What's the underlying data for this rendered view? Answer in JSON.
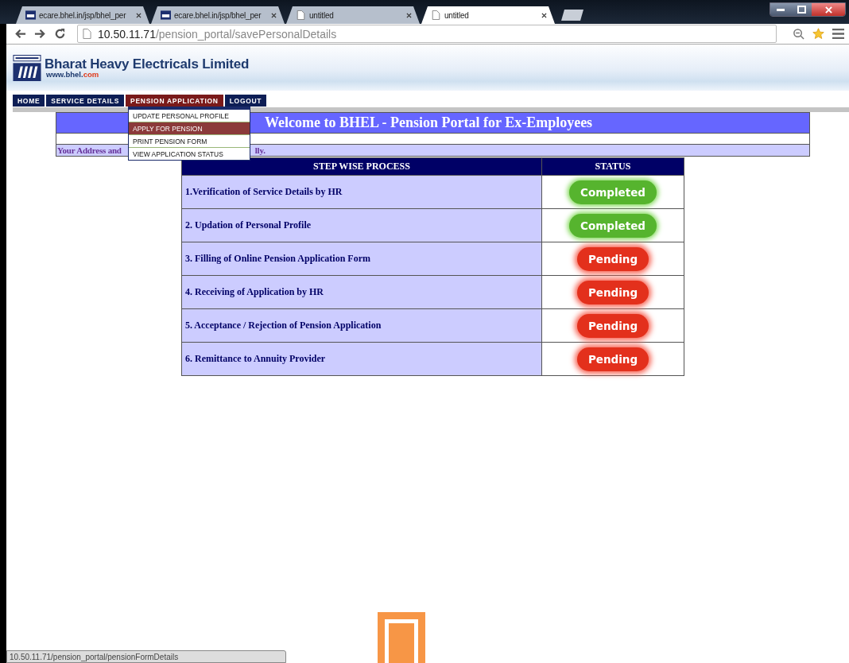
{
  "browser": {
    "tabs": [
      {
        "title": "ecare.bhel.in/jsp/bhel_per",
        "kind": "site",
        "selected": false
      },
      {
        "title": "ecare.bhel.in/jsp/bhel_per",
        "kind": "site",
        "selected": false
      },
      {
        "title": "untitled",
        "kind": "page",
        "selected": false
      },
      {
        "title": "untitled",
        "kind": "page",
        "selected": true
      }
    ],
    "url": {
      "host": "10.50.11.71",
      "path": "/pension_portal/savePersonalDetails"
    },
    "status_url": "10.50.11.71/pension_portal/pensionFormDetails"
  },
  "header": {
    "company": "Bharat Heavy Electricals Limited",
    "site": "www.bhel.",
    "site_tld": "com"
  },
  "nav": {
    "items": [
      {
        "label": "HOME",
        "selected": false
      },
      {
        "label": "SERVICE DETAILS",
        "selected": false
      },
      {
        "label": "PENSION APPLICATION",
        "selected": true
      },
      {
        "label": "LOGOUT",
        "selected": false
      }
    ],
    "dropdown": [
      {
        "label": "UPDATE PERSONAL PROFILE",
        "selected": false
      },
      {
        "label": "APPLY FOR PENSION",
        "selected": true
      },
      {
        "label": "PRINT PENSION FORM",
        "selected": false
      },
      {
        "label": "VIEW APPLICATION STATUS",
        "selected": false
      }
    ]
  },
  "welcome": {
    "title": "Welcome to BHEL - Pension Portal for Ex-Employees",
    "notice_start": "Your Address and",
    "notice_end": "lly."
  },
  "table": {
    "columns": [
      "STEP WISE PROCESS",
      "STATUS"
    ],
    "rows": [
      {
        "step": "1.Verification of Service Details by HR",
        "status": "Completed",
        "kind": "done"
      },
      {
        "step": "2. Updation of Personal Profile",
        "status": "Completed",
        "kind": "done"
      },
      {
        "step": "3. Filling of Online Pension Application Form",
        "status": "Pending",
        "kind": "pending"
      },
      {
        "step": "4. Receiving of Application by HR",
        "status": "Pending",
        "kind": "pending"
      },
      {
        "step": "5. Acceptance / Rejection of Pension Application",
        "status": "Pending",
        "kind": "pending"
      },
      {
        "step": "6. Remittance to Annuity Provider",
        "status": "Pending",
        "kind": "pending"
      }
    ]
  }
}
